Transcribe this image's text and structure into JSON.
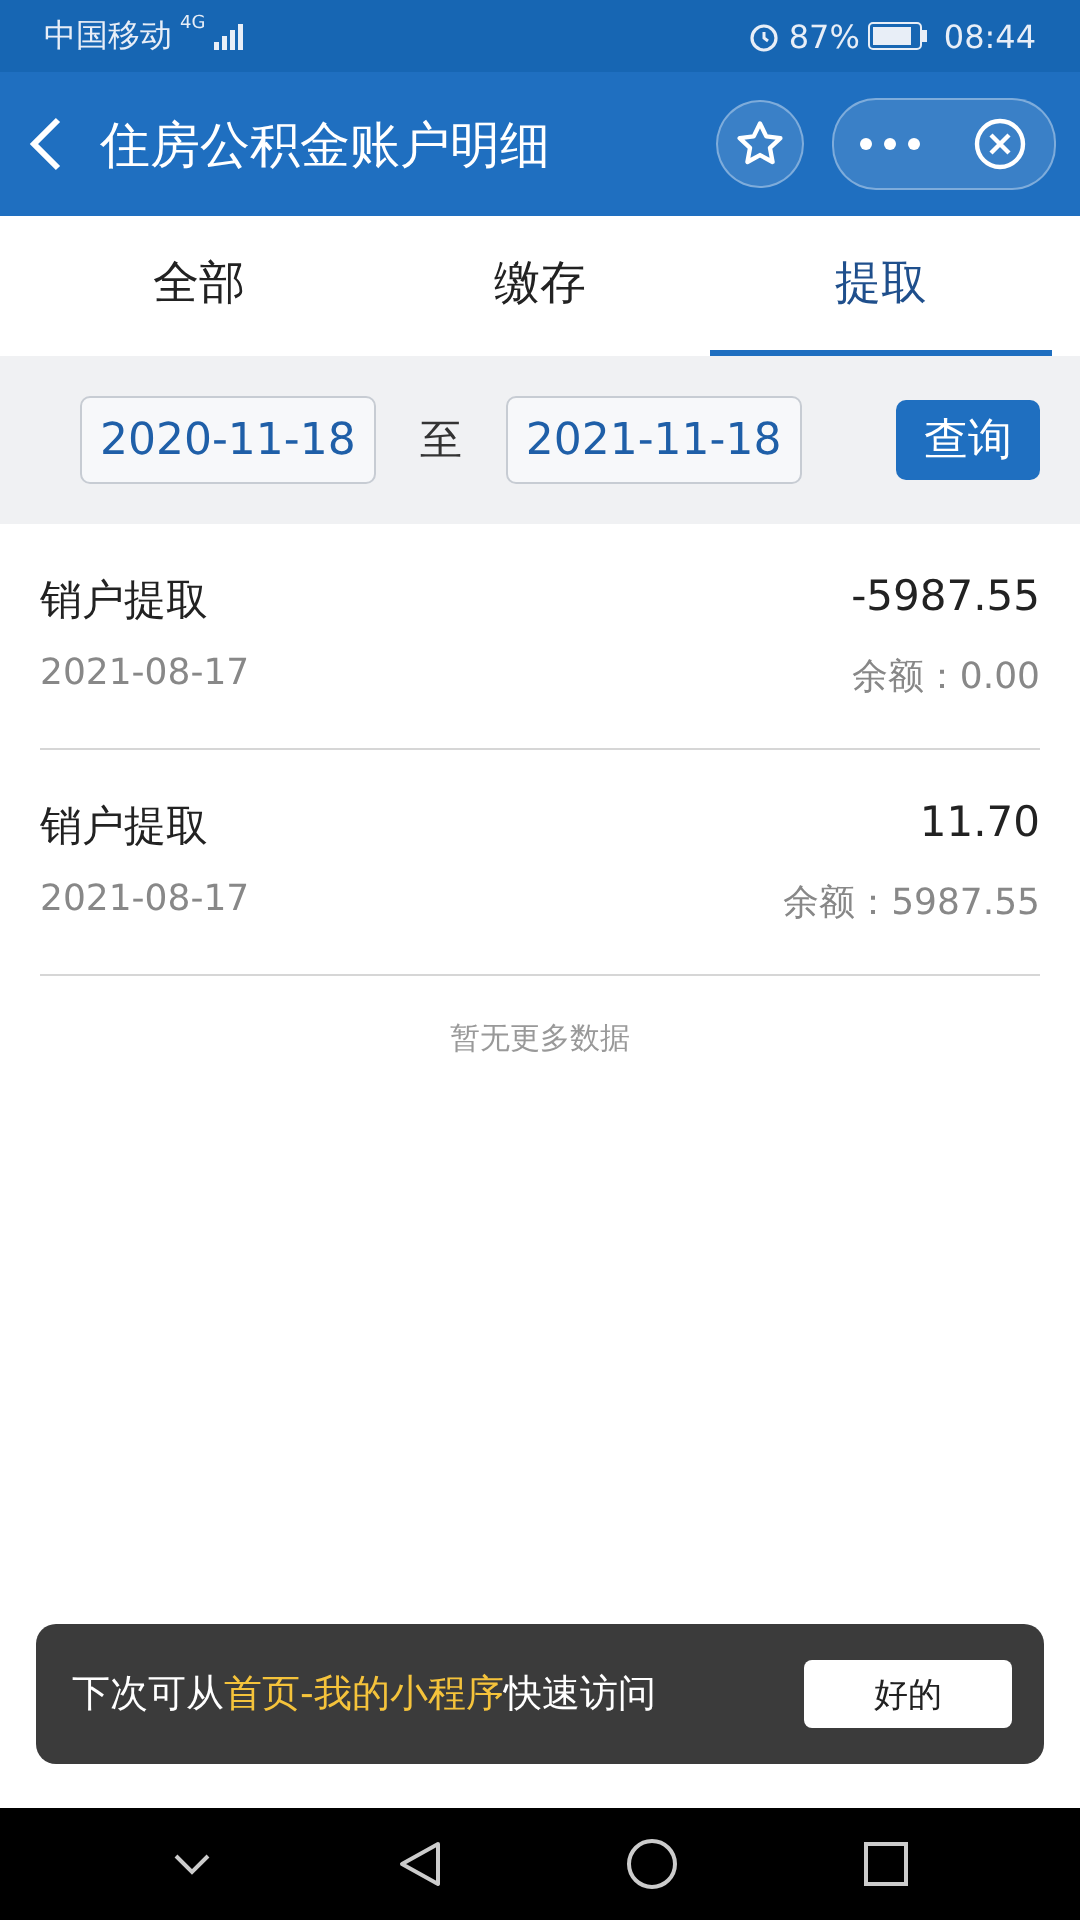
{
  "status_bar": {
    "carrier": "中国移动",
    "network": "4G",
    "battery": "87%",
    "time": "08:44"
  },
  "header": {
    "title": "住房公积金账户明细"
  },
  "tabs": [
    {
      "label": "全部",
      "selected": false
    },
    {
      "label": "缴存",
      "selected": false
    },
    {
      "label": "提取",
      "selected": true
    }
  ],
  "filter": {
    "start_date": "2020-11-18",
    "separator": "至",
    "end_date": "2021-11-18",
    "button": "查询"
  },
  "records": [
    {
      "type": "销户提取",
      "amount": "-5987.55",
      "date": "2021-08-17",
      "balance": "余额：0.00"
    },
    {
      "type": "销户提取",
      "amount": "11.70",
      "date": "2021-08-17",
      "balance": "余额：5987.55"
    }
  ],
  "empty_note": "暂无更多数据",
  "toast": {
    "text_before": "下次可从",
    "highlight": "首页-我的小程序",
    "text_after": "快速访问",
    "button": "好的"
  }
}
